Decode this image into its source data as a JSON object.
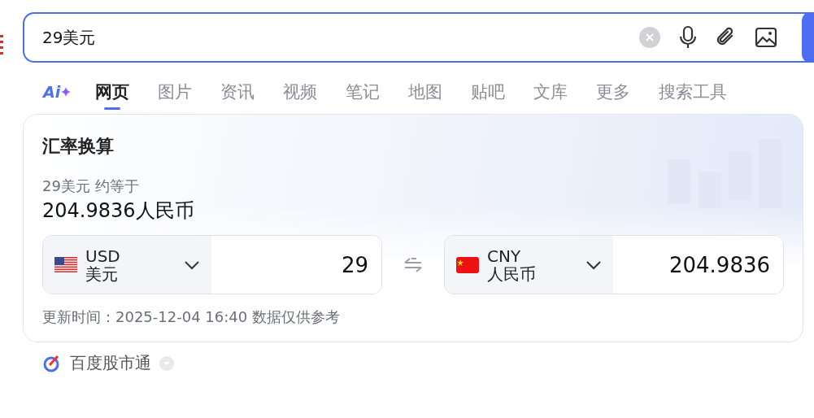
{
  "search": {
    "value": "29美元"
  },
  "tabs": [
    {
      "label": "网页",
      "selected": true
    },
    {
      "label": "图片",
      "selected": false
    },
    {
      "label": "资讯",
      "selected": false
    },
    {
      "label": "视频",
      "selected": false
    },
    {
      "label": "笔记",
      "selected": false
    },
    {
      "label": "地图",
      "selected": false
    },
    {
      "label": "贴吧",
      "selected": false
    },
    {
      "label": "文库",
      "selected": false
    },
    {
      "label": "更多",
      "selected": false
    },
    {
      "label": "搜索工具",
      "selected": false
    }
  ],
  "ai_label": "Ai",
  "card": {
    "title": "汇率换算",
    "summary": "29美元 约等于",
    "result": "204.9836人民币",
    "currencies": [
      {
        "kind": "us",
        "code": "USD",
        "name": "美元",
        "amount": "29"
      },
      {
        "kind": "cn",
        "code": "CNY",
        "name": "人民币",
        "amount": "204.9836"
      }
    ],
    "update_time": "更新时间：2025-12-04 16:40 数据仅供参考"
  },
  "source": {
    "label": "百度股市通"
  }
}
